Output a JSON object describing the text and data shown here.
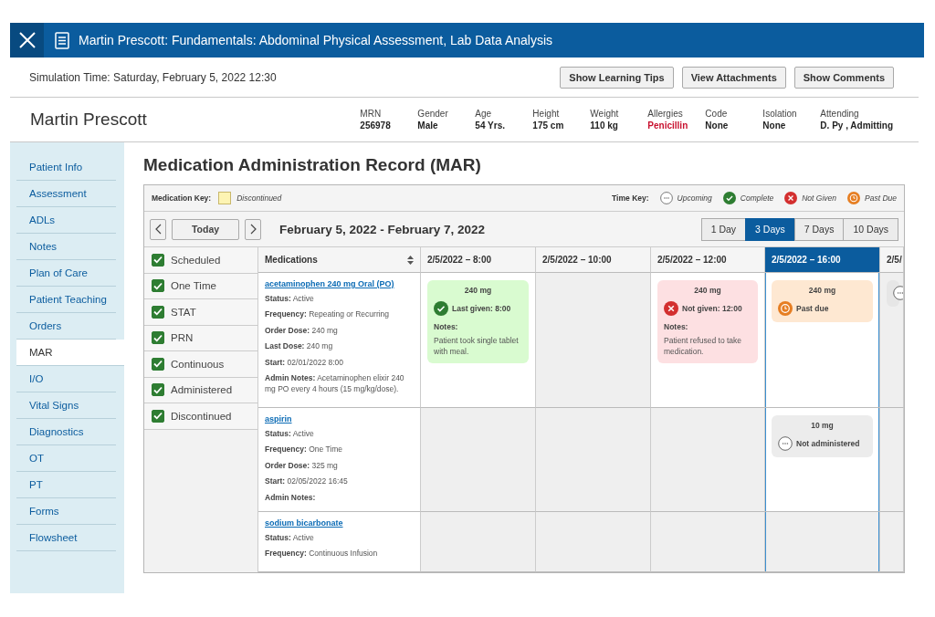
{
  "window": {
    "title": "Martin Prescott: Fundamentals: Abdominal Physical Assessment, Lab Data Analysis"
  },
  "simulation": {
    "time": "Simulation Time: Saturday, February 5, 2022 12:30",
    "buttons": [
      "Show Learning Tips",
      "View Attachments",
      "Show Comments"
    ]
  },
  "patient": {
    "name": "Martin Prescott",
    "fields": [
      {
        "label": "MRN",
        "value": "256978",
        "alert": false
      },
      {
        "label": "Gender",
        "value": "Male",
        "alert": false
      },
      {
        "label": "Age",
        "value": "54 Yrs.",
        "alert": false
      },
      {
        "label": "Height",
        "value": "175 cm",
        "alert": false
      },
      {
        "label": "Weight",
        "value": "110 kg",
        "alert": false
      },
      {
        "label": "Allergies",
        "value": "Penicillin",
        "alert": true
      },
      {
        "label": "Code",
        "value": "None",
        "alert": false
      },
      {
        "label": "Isolation",
        "value": "None",
        "alert": false
      },
      {
        "label": "Attending",
        "value": "D. Py , Admitting",
        "alert": false
      }
    ]
  },
  "sidebar": {
    "items": [
      {
        "label": "Patient Info",
        "selected": false
      },
      {
        "label": "Assessment",
        "selected": false
      },
      {
        "label": "ADLs",
        "selected": false
      },
      {
        "label": "Notes",
        "selected": false
      },
      {
        "label": "Plan of Care",
        "selected": false
      },
      {
        "label": "Patient Teaching",
        "selected": false
      },
      {
        "label": "Orders",
        "selected": false
      },
      {
        "label": "MAR",
        "selected": true
      },
      {
        "label": "I/O",
        "selected": false
      },
      {
        "label": "Vital Signs",
        "selected": false
      },
      {
        "label": "Diagnostics",
        "selected": false
      },
      {
        "label": "OT",
        "selected": false
      },
      {
        "label": "PT",
        "selected": false
      },
      {
        "label": "Forms",
        "selected": false
      },
      {
        "label": "Flowsheet",
        "selected": false
      }
    ]
  },
  "mar": {
    "title": "Medication Administration Record (MAR)",
    "medication_key": {
      "label": "Medication Key:",
      "items": [
        {
          "label": "Discontinued",
          "color": "#fdf4b3"
        }
      ]
    },
    "time_key": {
      "label": "Time Key:",
      "items": [
        {
          "kind": "upcoming",
          "label": "Upcoming"
        },
        {
          "kind": "complete",
          "label": "Complete"
        },
        {
          "kind": "not_given",
          "label": "Not Given"
        },
        {
          "kind": "past_due",
          "label": "Past Due"
        }
      ]
    },
    "toolbar": {
      "today": "Today",
      "range_label": "February 5, 2022 - February 7, 2022",
      "ranges": [
        {
          "label": "1 Day",
          "selected": false
        },
        {
          "label": "3 Days",
          "selected": true
        },
        {
          "label": "7 Days",
          "selected": false
        },
        {
          "label": "10 Days",
          "selected": false
        }
      ]
    },
    "filters": [
      {
        "label": "Scheduled",
        "checked": true
      },
      {
        "label": "One Time",
        "checked": true
      },
      {
        "label": "STAT",
        "checked": true
      },
      {
        "label": "PRN",
        "checked": true
      },
      {
        "label": "Continuous",
        "checked": true
      },
      {
        "label": "Administered",
        "checked": true
      },
      {
        "label": "Discontinued",
        "checked": true
      }
    ],
    "medications_header": "Medications",
    "columns": [
      {
        "label": "2/5/2022 – 8:00",
        "selected": false
      },
      {
        "label": "2/5/2022 – 10:00",
        "selected": false
      },
      {
        "label": "2/5/2022 – 12:00",
        "selected": false
      },
      {
        "label": "2/5/2022 – 16:00",
        "selected": true
      },
      {
        "label": "2/5/",
        "selected": false
      }
    ],
    "rows": [
      {
        "name": "acetaminophen 240 mg Oral (PO)",
        "details": [
          {
            "label": "Status:",
            "value": "Active"
          },
          {
            "label": "Frequency:",
            "value": "Repeating or Recurring"
          },
          {
            "label": "Order Dose:",
            "value": "240 mg"
          },
          {
            "label": "Last Dose:",
            "value": "240 mg"
          },
          {
            "label": "Start:",
            "value": "02/01/2022 8:00"
          },
          {
            "label": "Admin Notes:",
            "value": "Acetaminophen elixir 240 mg PO every 4 hours (15 mg/kg/dose)."
          }
        ],
        "cells": [
          {
            "shaded": false,
            "card": {
              "kind": "complete",
              "dose": "240 mg",
              "status": "Last given: 8:00",
              "notes_label": "Notes:",
              "notes": "Patient took single tablet with meal."
            }
          },
          {
            "shaded": true
          },
          {
            "shaded": false,
            "card": {
              "kind": "not_given",
              "dose": "240 mg",
              "status": "Not given: 12:00",
              "notes_label": "Notes:",
              "notes": "Patient refused to take medication."
            }
          },
          {
            "shaded": false,
            "card": {
              "kind": "past_due",
              "dose": "240 mg",
              "status": "Past due"
            }
          },
          {
            "shaded": true,
            "card": {
              "kind": "upcoming"
            }
          }
        ]
      },
      {
        "name": "aspirin",
        "details": [
          {
            "label": "Status:",
            "value": "Active"
          },
          {
            "label": "Frequency:",
            "value": "One Time"
          },
          {
            "label": "Order Dose:",
            "value": "325 mg"
          },
          {
            "label": "Start:",
            "value": "02/05/2022 16:45"
          },
          {
            "label": "Admin Notes:"
          }
        ],
        "cells": [
          {
            "shaded": true
          },
          {
            "shaded": true
          },
          {
            "shaded": true
          },
          {
            "shaded": false,
            "card": {
              "kind": "upcoming",
              "dose": "10 mg",
              "status": "Not administered"
            }
          },
          {
            "shaded": true
          }
        ]
      },
      {
        "name": "sodium bicarbonate",
        "details": [
          {
            "label": "Status:",
            "value": "Active"
          },
          {
            "label": "Frequency:",
            "value": "Continuous Infusion"
          }
        ],
        "cells": [
          {
            "shaded": true
          },
          {
            "shaded": true
          },
          {
            "shaded": true
          },
          {
            "shaded": true
          },
          {
            "shaded": true
          }
        ]
      }
    ]
  }
}
